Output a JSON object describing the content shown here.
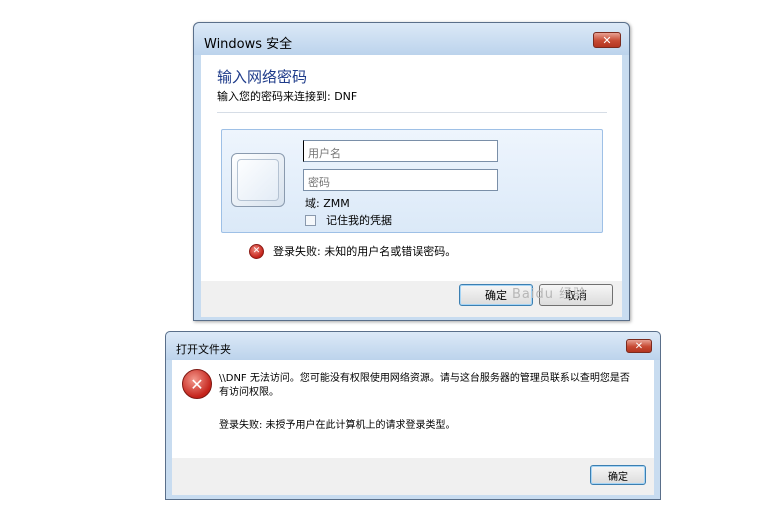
{
  "security_dialog": {
    "title": "Windows 安全",
    "close_label": "✕",
    "heading": "输入网络密码",
    "subheading": "输入您的密码来连接到: DNF",
    "username_placeholder": "用户名",
    "password_placeholder": "密码",
    "domain": "域: ZMM",
    "remember_label": "记住我的凭据",
    "error": "登录失败: 未知的用户名或错误密码。",
    "ok_label": "确定",
    "cancel_label": "取消"
  },
  "watermark": "Baidu 经验",
  "open_folder_dialog": {
    "title": "打开文件夹",
    "close_label": "✕",
    "message": "\\\\DNF 无法访问。您可能没有权限使用网络资源。请与这台服务器的管理员联系以查明您是否有访问权限。",
    "detail": "登录失败: 未授予用户在此计算机上的请求登录类型。",
    "ok_label": "确定"
  },
  "colors": {
    "heading_blue": "#1e3b8a",
    "close_red": "#c74a33",
    "error_red": "#c4221a",
    "frame_blue": "#c8dcf0"
  }
}
